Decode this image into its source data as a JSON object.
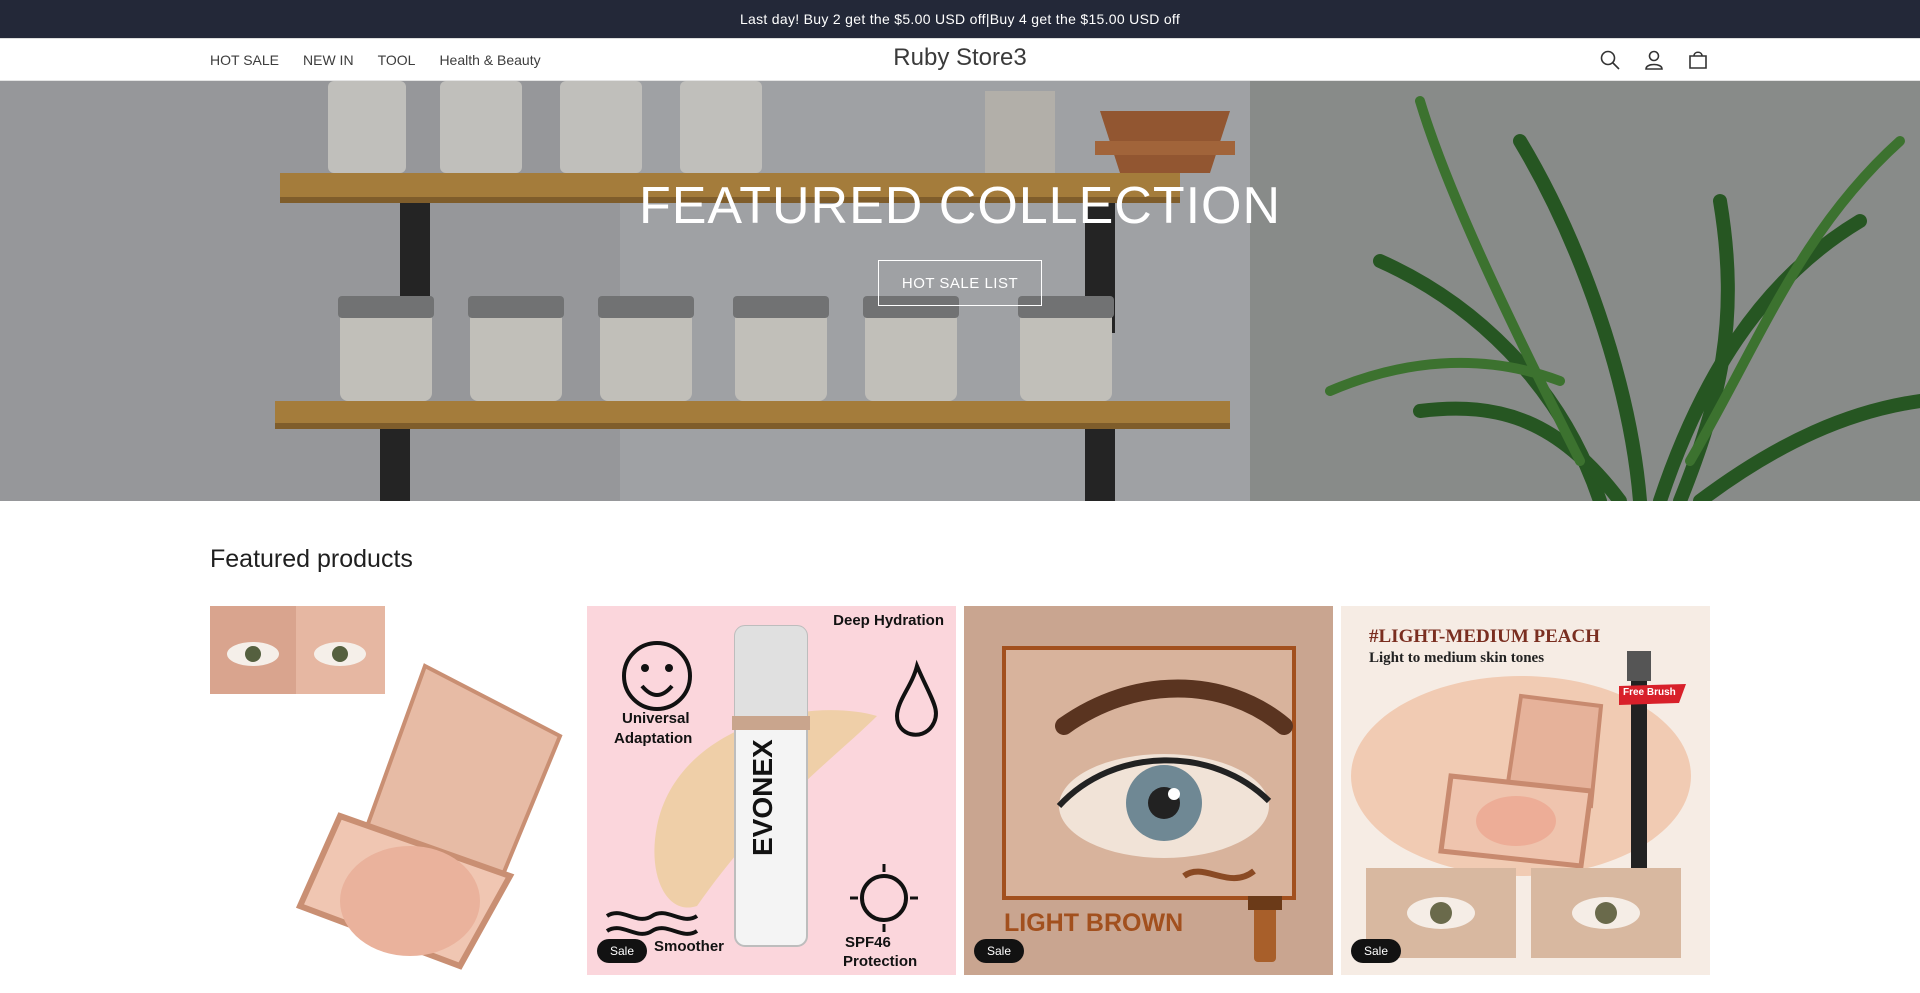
{
  "announcement": {
    "text": "Last day!   Buy 2 get the  $5.00 USD off|Buy 4 get the  $15.00 USD off"
  },
  "header": {
    "store_name": "Ruby Store3",
    "nav": [
      {
        "label": "HOT SALE"
      },
      {
        "label": "NEW IN"
      },
      {
        "label": "TOOL"
      },
      {
        "label": "Health & Beauty"
      }
    ],
    "icons": [
      "search-icon",
      "account-icon",
      "cart-icon"
    ]
  },
  "hero": {
    "title": "FEATURED COLLECTION",
    "button_label": "HOT SALE LIST"
  },
  "featured": {
    "title": "Featured products",
    "products": [
      {
        "badge": null
      },
      {
        "badge": "Sale",
        "texts": {
          "deep": "Deep Hydration",
          "universal": "Universal",
          "adaptation": "Adaptation",
          "smoother": "Smoother",
          "spf": "SPF46",
          "protection": "Protection",
          "brand": "EVONEX"
        }
      },
      {
        "badge": "Sale",
        "texts": {
          "shade": "LIGHT BROWN"
        }
      },
      {
        "badge": "Sale",
        "texts": {
          "shade": "#LIGHT-MEDIUM PEACH",
          "tone": "Light to medium skin tones",
          "tag": "Free Brush"
        }
      }
    ]
  },
  "colors": {
    "announce_bg": "#232838",
    "badge_bg": "#121212",
    "card2_bg": "#fbd6dc",
    "card3_bg": "#c9a590",
    "accent_brown": "#a2501e",
    "tag_red": "#d8202a"
  }
}
